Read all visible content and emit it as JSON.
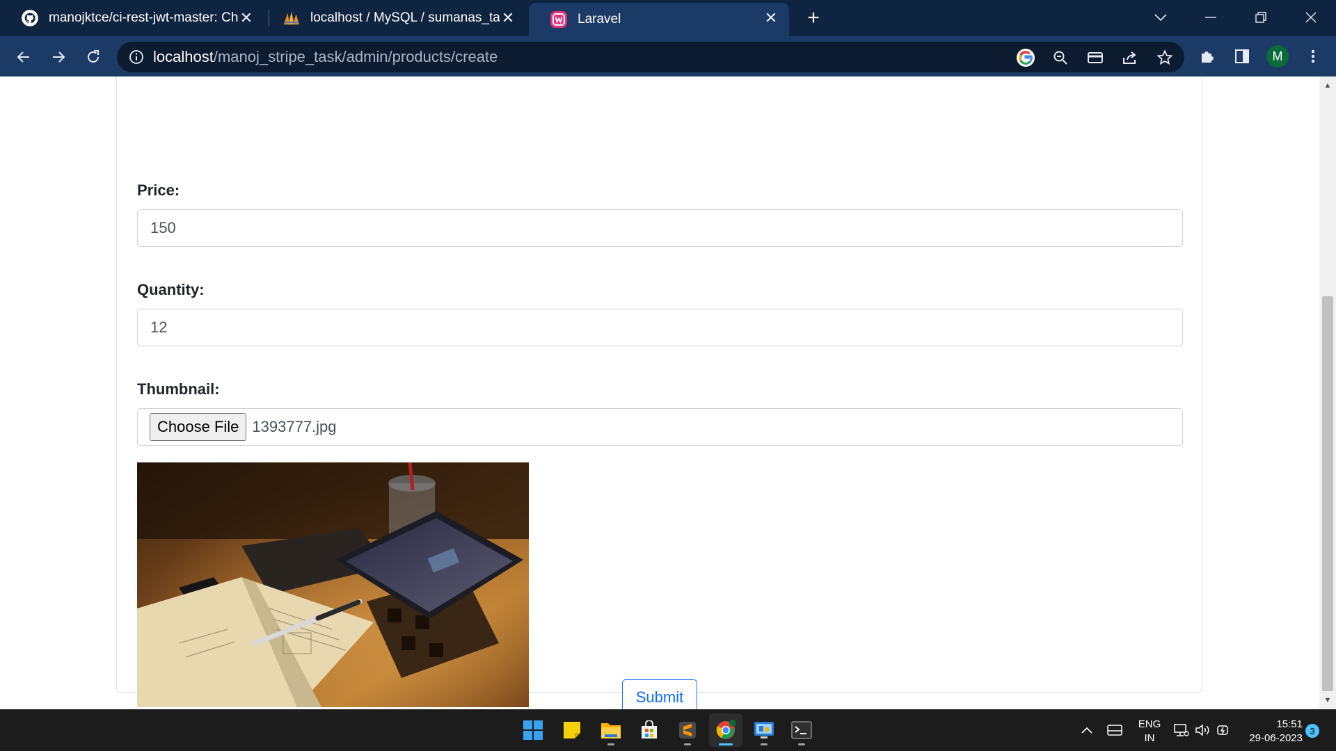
{
  "browser": {
    "tabs": [
      {
        "title": "manojktce/ci-rest-jwt-master: Ch",
        "icon": "github-icon"
      },
      {
        "title": "localhost / MySQL / sumanas_tas",
        "icon": "phpmyadmin-icon"
      },
      {
        "title": "Laravel",
        "icon": "laravel-icon"
      }
    ],
    "url_host": "localhost",
    "url_path": "/manoj_stripe_task/admin/products/create",
    "profile_initial": "M",
    "colors": {
      "tabbar": "#0f2440",
      "toolbar": "#1c3a66",
      "omnibox": "#0c1b30"
    }
  },
  "form": {
    "price_label": "Price:",
    "price_value": "150",
    "quantity_label": "Quantity:",
    "quantity_value": "12",
    "thumbnail_label": "Thumbnail:",
    "choose_file_label": "Choose File",
    "file_name": "1393777.jpg",
    "submit_label": "Submit",
    "accent_color": "#0d6efd"
  },
  "taskbar": {
    "apps": [
      "windows-start-icon",
      "sticky-notes-icon",
      "file-explorer-icon",
      "microsoft-store-icon",
      "sublime-text-icon",
      "chrome-icon",
      "control-panel-icon",
      "terminal-icon"
    ],
    "lang_primary": "ENG",
    "lang_secondary": "IN",
    "time": "15:51",
    "date": "29-06-2023",
    "notification_count": "3"
  }
}
